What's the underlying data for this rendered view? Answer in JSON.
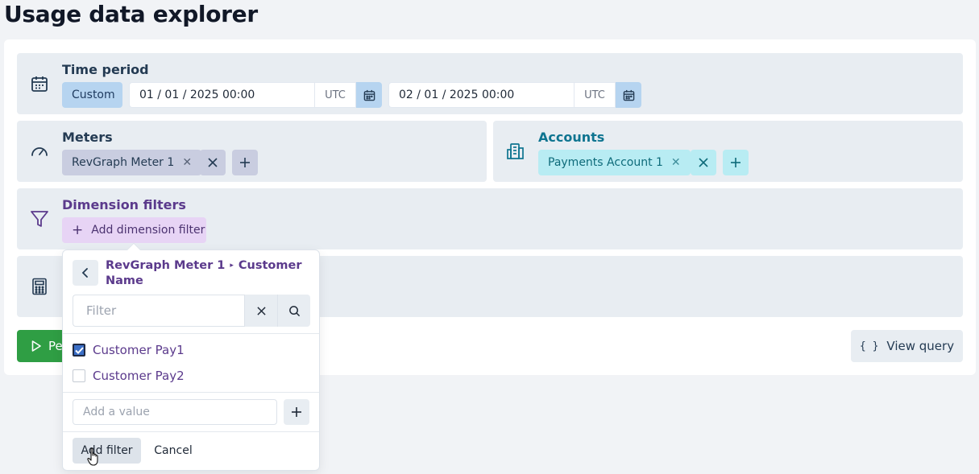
{
  "page": {
    "title": "Usage data explorer"
  },
  "time_period": {
    "title": "Time period",
    "preset": "Custom",
    "start": {
      "value": "01 / 01 / 2025 00:00",
      "tz": "UTC"
    },
    "end": {
      "value": "02 / 01 / 2025 00:00",
      "tz": "UTC"
    }
  },
  "meters": {
    "title": "Meters",
    "selected": "RevGraph Meter 1"
  },
  "accounts": {
    "title": "Accounts",
    "selected": "Payments Account 1"
  },
  "dimension_filters": {
    "title": "Dimension filters",
    "add_label": "Add dimension filter"
  },
  "actions": {
    "run_label_partial": "Pe",
    "view_query_label": "View query",
    "view_query_icon": "{ }"
  },
  "popover": {
    "path_meter": "RevGraph Meter 1",
    "path_sep": "▸",
    "path_dimension": "Customer Name",
    "filter_placeholder": "Filter",
    "options": [
      {
        "label": "Customer Pay1",
        "checked": true
      },
      {
        "label": "Customer Pay2",
        "checked": false
      }
    ],
    "add_value_placeholder": "Add a value",
    "add_filter_label": "Add filter",
    "cancel_label": "Cancel"
  },
  "colors": {
    "section_bg": "#e8edf2",
    "meter_chip": "#c9cde0",
    "account_chip": "#b8ecf3",
    "dimension_chip": "#e7d4f5",
    "run_button": "#2f9e44",
    "calendar_button": "#b6d4f0"
  }
}
